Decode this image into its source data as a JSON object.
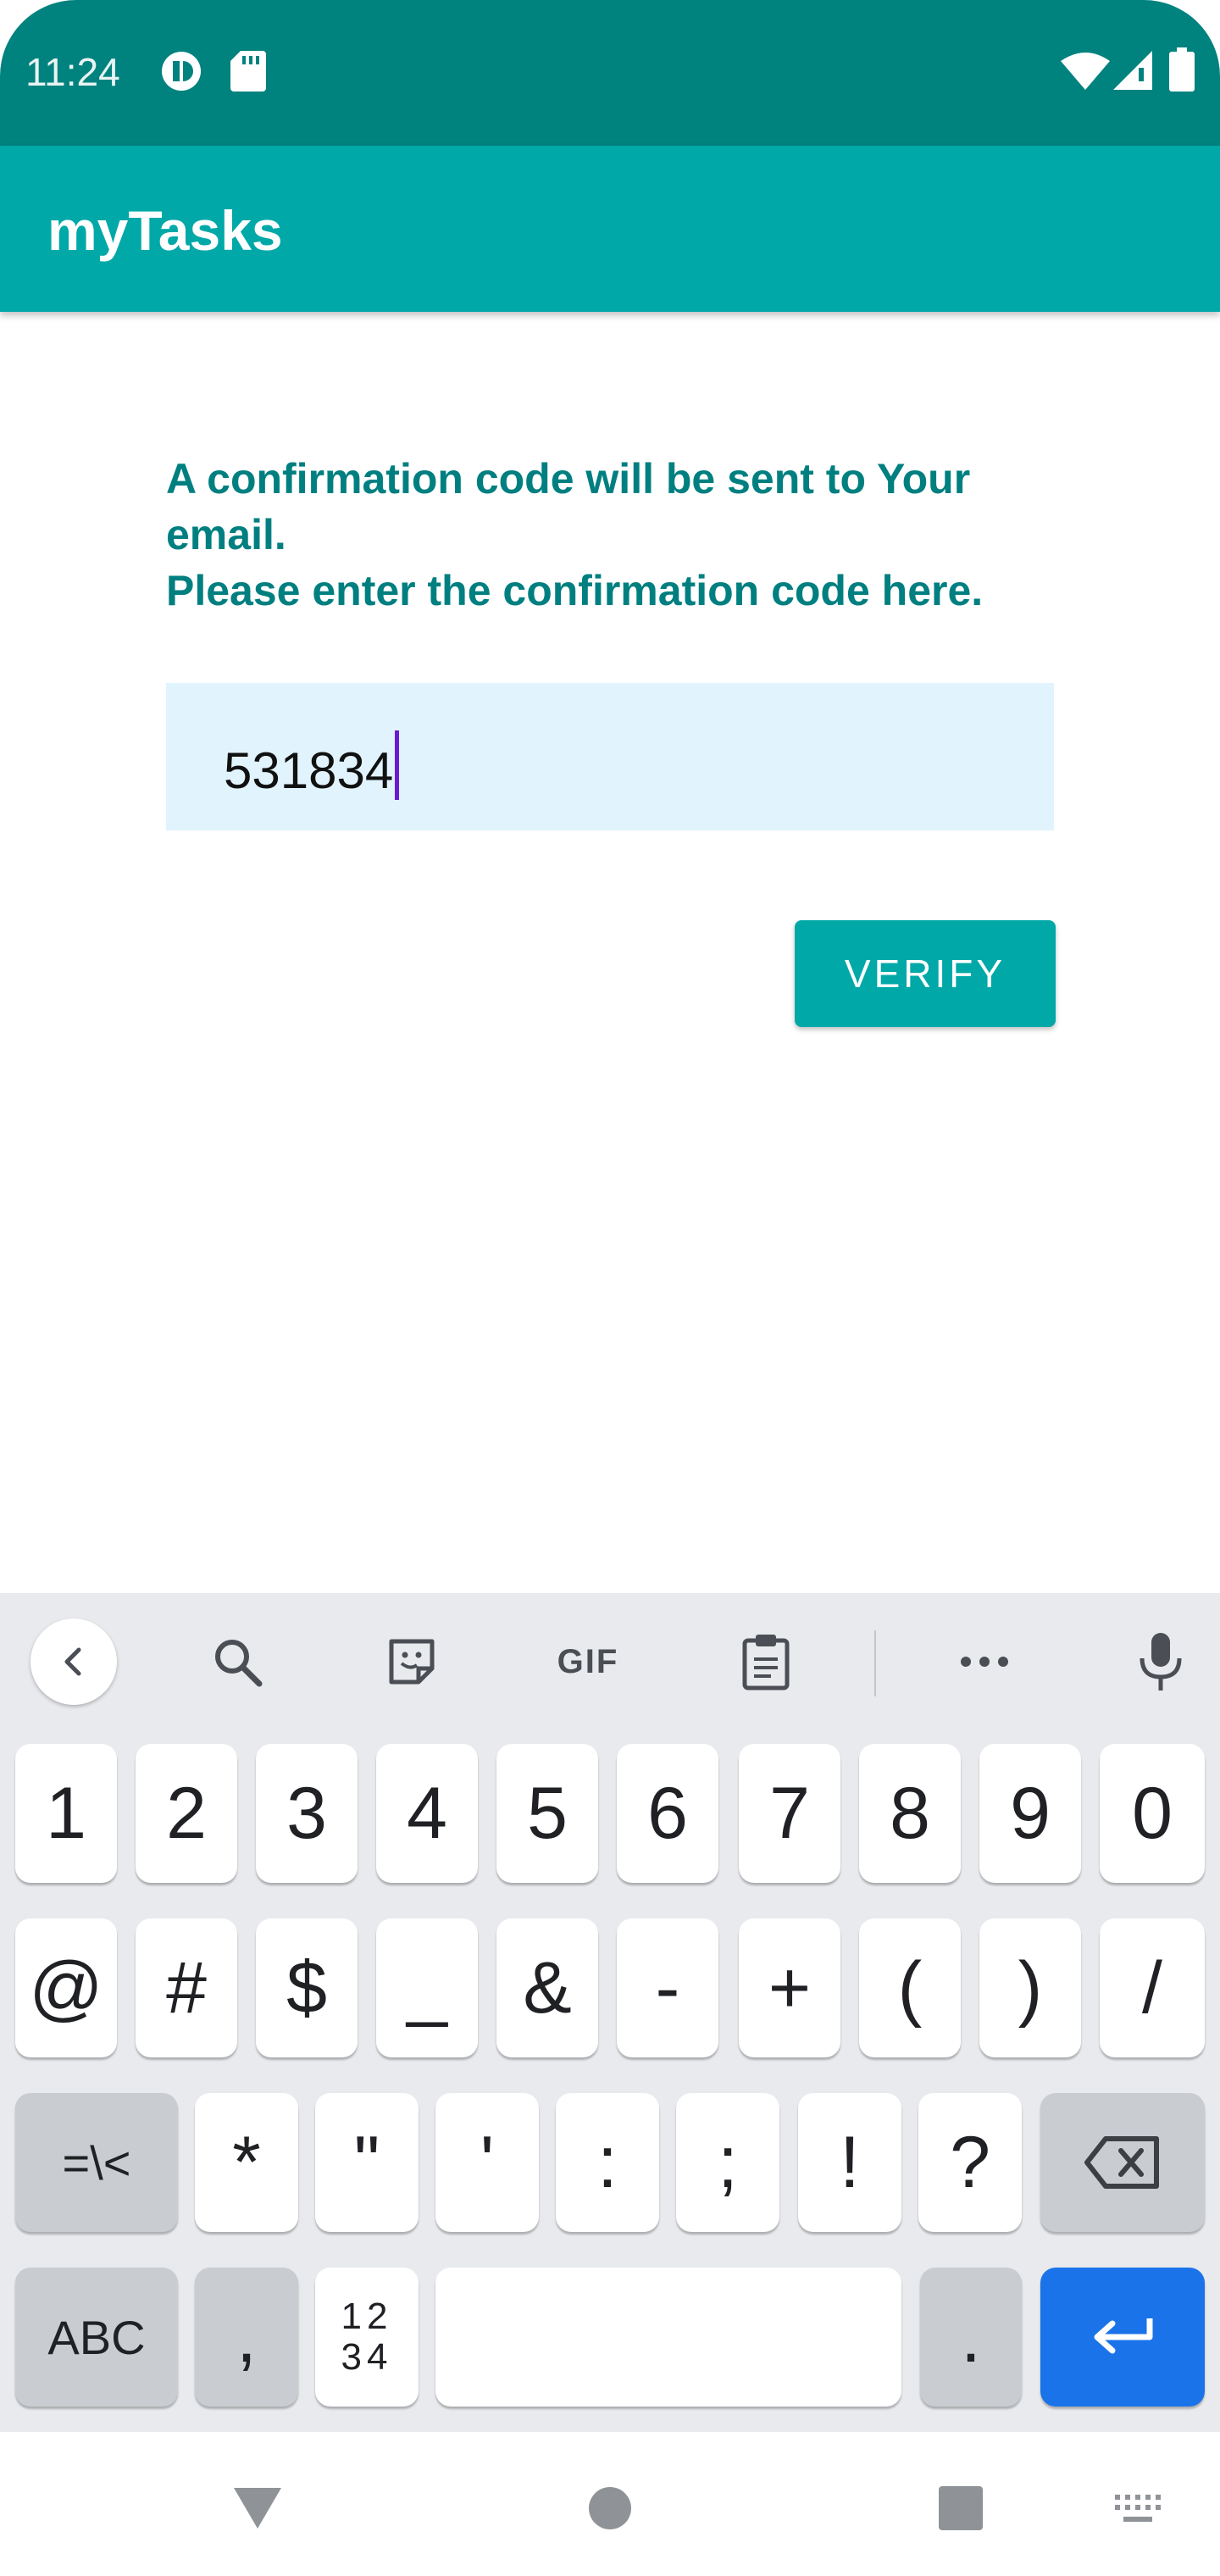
{
  "status_bar": {
    "time": "11:24"
  },
  "app_bar": {
    "title": "myTasks"
  },
  "content": {
    "message_lines": [
      "A confirmation code will be sent to Your",
      "email.",
      "Please enter the confirmation code here."
    ],
    "code_value": "531834",
    "verify_label": "VERIFY"
  },
  "keyboard": {
    "toolbar": {
      "gif_label": "GIF"
    },
    "row1": [
      "1",
      "2",
      "3",
      "4",
      "5",
      "6",
      "7",
      "8",
      "9",
      "0"
    ],
    "row2": [
      "@",
      "#",
      "$",
      "_",
      "&",
      "-",
      "+",
      "(",
      ")",
      "/"
    ],
    "row3": {
      "mode_key": "=\\<",
      "keys": [
        "*",
        "\"",
        "'",
        ":",
        ";",
        "!",
        "?"
      ]
    },
    "row4": {
      "abc": "ABC",
      "comma": ",",
      "numpad_top": "12",
      "numpad_bottom": "34",
      "period": "."
    }
  },
  "colors": {
    "status_bar": "#00827f",
    "app_bar": "#00a8a8",
    "message_text": "#007f80",
    "field_bg": "#e1f4fd",
    "enter_key": "#1a73e8"
  }
}
